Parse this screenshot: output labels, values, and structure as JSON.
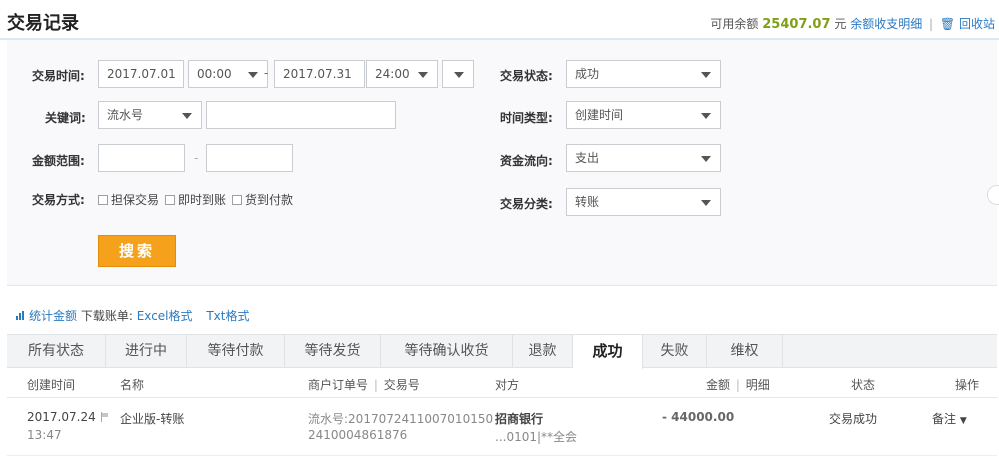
{
  "header": {
    "title": "交易记录",
    "balance_label": "可用余额",
    "balance_value": "25407.07",
    "balance_unit": "元",
    "detail_link": "余额收支明细",
    "divider": "|",
    "trash_link": "回收站"
  },
  "filters": {
    "time_label": "交易时间:",
    "start_date": "2017.07.01",
    "start_time": "00:00",
    "range_sep": "-",
    "end_date": "2017.07.31",
    "end_time": "24:00",
    "keyword_label": "关键词:",
    "keyword_type": "流水号",
    "keyword_value": "",
    "amount_label": "金额范围:",
    "amount_min": "",
    "amount_max": "",
    "amount_sep": "-",
    "mode_label": "交易方式:",
    "modes": [
      "担保交易",
      "即时到账",
      "货到付款"
    ],
    "status_label": "交易状态:",
    "status_value": "成功",
    "time_type_label": "时间类型:",
    "time_type_value": "创建时间",
    "flow_label": "资金流向:",
    "flow_value": "支出",
    "category_label": "交易分类:",
    "category_value": "转账",
    "search_button": "搜索"
  },
  "download": {
    "stats_link": "统计金额",
    "download_label": "下载账单:",
    "excel_link": "Excel格式",
    "txt_link": "Txt格式"
  },
  "tabs": [
    "所有状态",
    "进行中",
    "等待付款",
    "等待发货",
    "等待确认收货",
    "退款",
    "成功",
    "失败",
    "维权"
  ],
  "active_tab": "成功",
  "columns": {
    "created": "创建时间",
    "name": "名称",
    "order": "商户订单号",
    "order_sep": "|",
    "txn": "交易号",
    "counterparty": "对方",
    "amount": "金额",
    "amount_sep": "|",
    "detail": "明细",
    "status": "状态",
    "action": "操作"
  },
  "rows": [
    {
      "date": "2017.07.24",
      "time": "13:47",
      "name": "企业版-转账",
      "serial_line1": "流水号:2017072411007010150",
      "serial_line2": "2410004861876",
      "counterparty": "招商银行",
      "counterparty_sub": "...0101|**全会",
      "amount": "- 44000.00",
      "status": "交易成功",
      "action": "备注"
    }
  ],
  "colors": {
    "accent_link": "#2a7ac0",
    "balance": "#7fa014",
    "search_button": "#f6a11c"
  }
}
